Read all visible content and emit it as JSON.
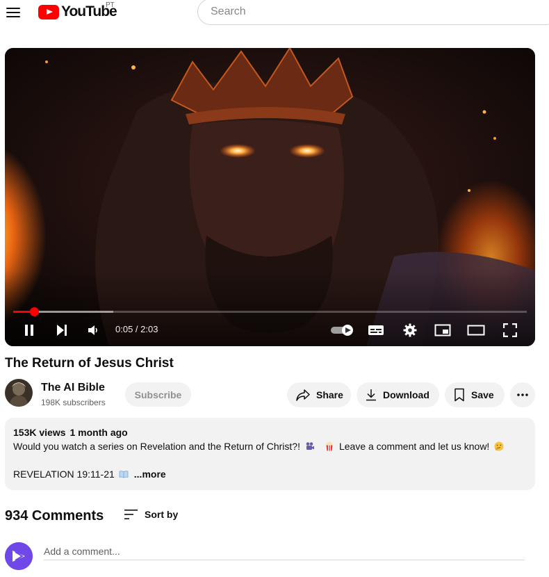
{
  "header": {
    "logo_text": "YouTube",
    "region_code": "PT",
    "search_placeholder": "Search"
  },
  "player": {
    "time_display": "0:05 / 2:03",
    "progress_played_fraction": 0.04,
    "progress_loaded_fraction": 0.195,
    "state": "playing",
    "autoplay_enabled": true
  },
  "video": {
    "title": "The Return of Jesus Christ"
  },
  "channel": {
    "name": "The AI Bible",
    "subscribers": "198K subscribers",
    "subscribe_label": "Subscribe"
  },
  "actions": {
    "share_label": "Share",
    "download_label": "Download",
    "save_label": "Save"
  },
  "description": {
    "views": "153K views",
    "date": "1 month ago",
    "line1_a": "Would you watch a series on Revelation and the Return of Christ?!",
    "line1_b": "Leave a comment and let us know!",
    "line2": "REVELATION 19:11-21",
    "more_label": "...more"
  },
  "comments": {
    "count_label": "934 Comments",
    "sort_label": "Sort by",
    "input_placeholder": "Add a comment..."
  },
  "icons": {
    "menu": "hamburger-menu-icon",
    "share": "share-arrow-icon",
    "download": "download-icon",
    "save": "bookmark-icon",
    "more": "more-horizontal-icon",
    "sort": "sort-lines-icon"
  },
  "colors": {
    "brand_red": "#ff0000",
    "chip_background": "#f2f2f2",
    "secondary_text": "#606060"
  }
}
